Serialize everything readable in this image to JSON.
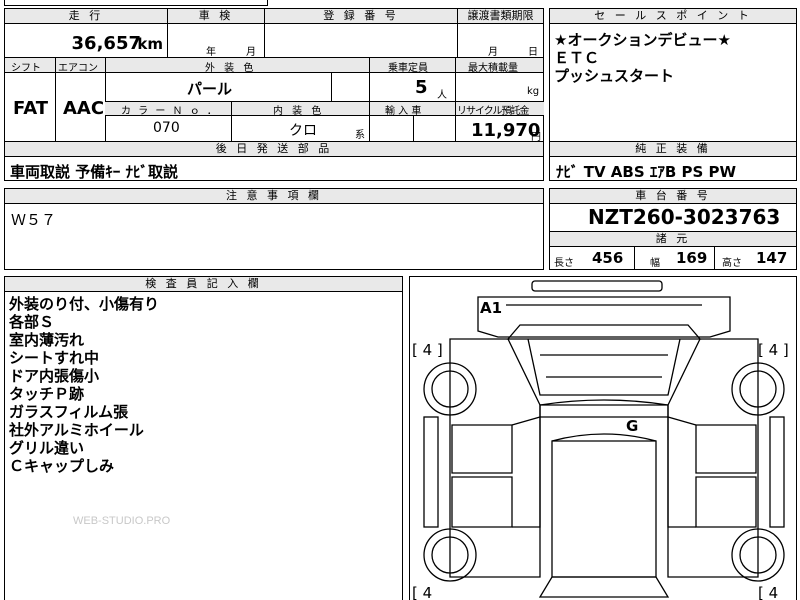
{
  "headers": {
    "mileage": "走 行",
    "shaken": "車 検",
    "registration": "登 録 番 号",
    "transfer_deadline": "譲渡書類期限",
    "sales_point": "セ ー ル ス ポ イ ン ト",
    "shift": "シフト",
    "aircon": "エアコン",
    "exterior_color": "外 装 色",
    "capacity": "乗車定員",
    "max_load": "最大積載量",
    "color_no": "カ ラ ー Ｎ ｏ ．",
    "interior_color": "内 装 色",
    "import": "輸 入 車",
    "recycle": "リサイクル預託金",
    "later_parts": "後 日 発 送 部 品",
    "genuine_equipment": "純 正 装 備",
    "notes": "注 意 事 項 欄",
    "chassis_no": "車 台 番 号",
    "specs": "諸 元",
    "inspector": "検 査 員 記 入 欄"
  },
  "vehicle": {
    "mileage_value": "36,657",
    "mileage_unit": "km",
    "shaken_year_unit": "年",
    "shaken_month_unit": "月",
    "transfer_month_unit": "月",
    "transfer_day_unit": "日",
    "shift": "FAT",
    "aircon": "AAC",
    "exterior_color": "パール",
    "capacity": "5",
    "capacity_unit": "人",
    "load_unit": "kg",
    "color_no": "070",
    "interior_color": "クロ",
    "interior_suffix": "系",
    "recycle_value": "11,970",
    "recycle_unit": "円",
    "later_parts": "車両取説 予備ｷｰ ﾅﾋﾞ取説",
    "genuine_equipment": "ﾅﾋﾞ TV ABS ｴｱB PS PW",
    "notes": "Ｗ５７",
    "chassis_no": "NZT260-3023763",
    "length_label": "長さ",
    "length": "456",
    "width_label": "幅",
    "width": "169",
    "height_label": "高さ",
    "height": "147"
  },
  "sales_points": [
    "★オークションデビュー★",
    "ＥＴＣ",
    "プッシュスタート"
  ],
  "inspector_notes": [
    "外装のり付、小傷有り",
    "各部Ｓ",
    "室内薄汚れ",
    "シートすれ中",
    "ドア内張傷小",
    "タッチＰ跡",
    "ガラスフィルム張",
    "社外アルミホイール",
    "グリル違い",
    "Ｃキャップしみ"
  ],
  "diagram": {
    "mark_a1": "A1",
    "mark_g": "G",
    "tire_fl": "[ 4 ]",
    "tire_fr": "[ 4 ]",
    "tire_rl": "[ 4",
    "tire_rr": "[ 4"
  },
  "watermark": "WEB-STUDIO.PRO"
}
